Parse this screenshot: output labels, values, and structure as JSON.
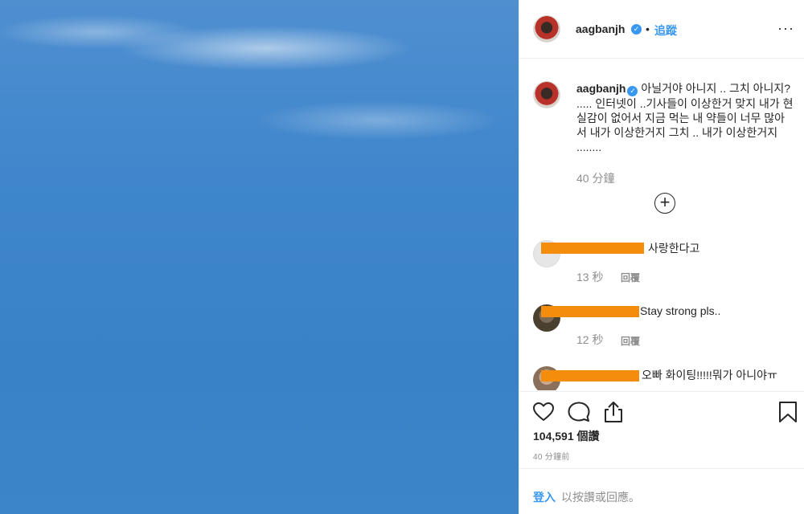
{
  "header": {
    "username": "aagbanjh",
    "verified_icon": "verified-badge-icon",
    "separator": "•",
    "follow_label": "追蹤",
    "more_icon": "more-options-icon",
    "more_glyph": "···"
  },
  "caption": {
    "username": "aagbanjh",
    "text": "아닐거야 아니지 .. 그치 아니지? ..... 인터넷이 ..기사들이 이상한거 맞지 내가 현실감이 없어서 지금 먹는 내 약들이 너무 많아서 내가 이상한거지 그치 .. 내가 이상한거지 ........",
    "time": "40 分鐘",
    "load_more_glyph": "+"
  },
  "comments": [
    {
      "text": "사랑한다고",
      "time": "13 秒",
      "reply": "回覆"
    },
    {
      "text": "Stay strong pls..",
      "time": "12 秒",
      "reply": "回覆"
    },
    {
      "text": "오빠 화이팅!!!!!뭐가 아니야ㅠ",
      "time": "",
      "reply": ""
    }
  ],
  "actions": {
    "like_icon": "heart-icon",
    "comment_icon": "comment-icon",
    "share_icon": "share-icon",
    "save_icon": "bookmark-icon"
  },
  "likes": "104,591 個讚",
  "posted_time": "40 分鐘前",
  "footer": {
    "login_label": "登入",
    "login_rest": "以按讚或回應。"
  },
  "colors": {
    "accent": "#3897f0",
    "redaction": "#f58d0c",
    "sky": "#3f86cc",
    "muted": "#8e8e8e"
  }
}
